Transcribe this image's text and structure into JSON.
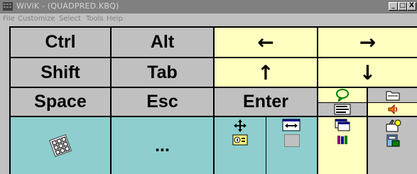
{
  "window": {
    "title": "WiViK - (QUADPRED.KBQ)",
    "min": "_",
    "max": "□",
    "close": "X"
  },
  "menu": {
    "file": "File",
    "customize": "Customize",
    "select": "Select",
    "tools": "Tools",
    "help": "Help"
  },
  "keys": {
    "ctrl": "Ctrl",
    "alt": "Alt",
    "left": "←",
    "right": "→",
    "shift": "Shift",
    "tab": "Tab",
    "up": "↑",
    "down": "↓",
    "space": "Space",
    "esc": "Esc",
    "enter": "Enter",
    "more": "..."
  },
  "colors": {
    "gray": "#c0c0c0",
    "yellow": "#ffffc0",
    "teal": "#8ecece",
    "titlebar": "#808080"
  },
  "icons": [
    "wivik-app-icon",
    "speech-bubble-icon",
    "keyboard-list-icon",
    "folder-icon",
    "speaker-icon",
    "move-arrows-icon",
    "info-icon",
    "resize-arrows-icon",
    "window-icon",
    "people-icon",
    "toolbox-icon",
    "calculator-icon",
    "keypad-icon"
  ]
}
